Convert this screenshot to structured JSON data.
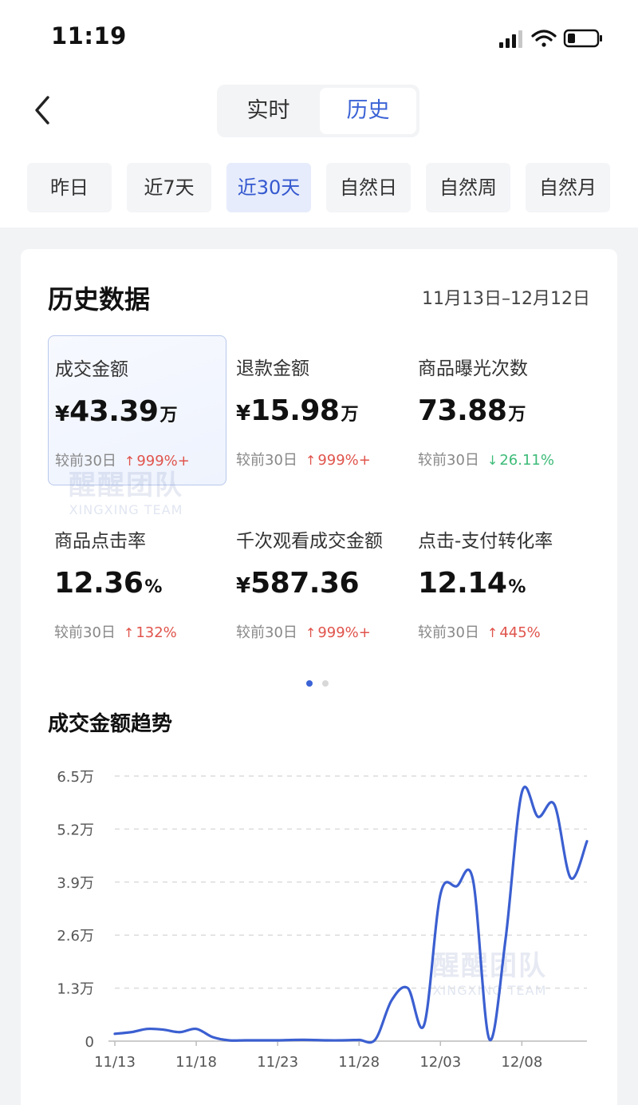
{
  "status_bar": {
    "time": "11:19"
  },
  "tabs": [
    {
      "label": "实时",
      "active": false
    },
    {
      "label": "历史",
      "active": true
    }
  ],
  "date_filters": [
    {
      "label": "昨日",
      "active": false
    },
    {
      "label": "近7天",
      "active": false
    },
    {
      "label": "近30天",
      "active": true
    },
    {
      "label": "自然日",
      "active": false
    },
    {
      "label": "自然周",
      "active": false
    },
    {
      "label": "自然月",
      "active": false
    }
  ],
  "card": {
    "title": "历史数据",
    "date_range": "11月13日–12月12日",
    "metrics": [
      {
        "label": "成交金额",
        "currency": "¥",
        "value": "43.39",
        "unit": "万",
        "compare_label": "较前30日",
        "direction": "up",
        "arrow": "↑",
        "change": "999%+",
        "selected": true
      },
      {
        "label": "退款金额",
        "currency": "¥",
        "value": "15.98",
        "unit": "万",
        "compare_label": "较前30日",
        "direction": "up",
        "arrow": "↑",
        "change": "999%+",
        "selected": false
      },
      {
        "label": "商品曝光次数",
        "currency": "",
        "value": "73.88",
        "unit": "万",
        "compare_label": "较前30日",
        "direction": "down",
        "arrow": "↓",
        "change": "26.11%",
        "selected": false
      },
      {
        "label": "商品点击率",
        "currency": "",
        "value": "12.36",
        "unit": "%",
        "compare_label": "较前30日",
        "direction": "up",
        "arrow": "↑",
        "change": "132%",
        "selected": false
      },
      {
        "label": "千次观看成交金额",
        "currency": "¥",
        "value": "587.36",
        "unit": "",
        "compare_label": "较前30日",
        "direction": "up",
        "arrow": "↑",
        "change": "999%+",
        "selected": false
      },
      {
        "label": "点击-支付转化率",
        "currency": "",
        "value": "12.14",
        "unit": "%",
        "compare_label": "较前30日",
        "direction": "up",
        "arrow": "↑",
        "change": "445%",
        "selected": false
      }
    ],
    "pager": {
      "count": 2,
      "current": 0
    },
    "trend_title": "成交金额趋势"
  },
  "watermark": {
    "cn": "醒醒团队",
    "en": "XINGXING TEAM"
  },
  "colors": {
    "accent": "#3b63d6",
    "up": "#e0544c",
    "down": "#3dbb78",
    "line": "#3b5fd1"
  },
  "chart_data": {
    "type": "line",
    "title": "成交金额趋势",
    "xlabel": "",
    "ylabel": "",
    "ylim": [
      0,
      6.5
    ],
    "y_ticks": [
      0,
      1.3,
      2.6,
      3.9,
      5.2,
      6.5
    ],
    "y_tick_labels": [
      "0",
      "1.3万",
      "2.6万",
      "3.9万",
      "5.2万",
      "6.5万"
    ],
    "x_tick_labels": [
      "11/13",
      "11/18",
      "11/23",
      "11/28",
      "12/03",
      "12/08"
    ],
    "grid": true,
    "x": [
      "11/13",
      "11/14",
      "11/15",
      "11/16",
      "11/17",
      "11/18",
      "11/19",
      "11/20",
      "11/21",
      "11/22",
      "11/23",
      "11/24",
      "11/25",
      "11/26",
      "11/27",
      "11/28",
      "11/29",
      "11/30",
      "12/01",
      "12/02",
      "12/03",
      "12/04",
      "12/05",
      "12/06",
      "12/07",
      "12/08",
      "12/09",
      "12/10",
      "12/11",
      "12/12"
    ],
    "series": [
      {
        "values": [
          0.18,
          0.22,
          0.3,
          0.28,
          0.22,
          0.3,
          0.1,
          0.02,
          0.02,
          0.02,
          0.02,
          0.03,
          0.03,
          0.02,
          0.02,
          0.03,
          0.04,
          1.0,
          1.3,
          0.4,
          3.6,
          3.8,
          3.95,
          0.05,
          2.5,
          6.1,
          5.5,
          5.8,
          4.0,
          4.9
        ]
      }
    ]
  }
}
